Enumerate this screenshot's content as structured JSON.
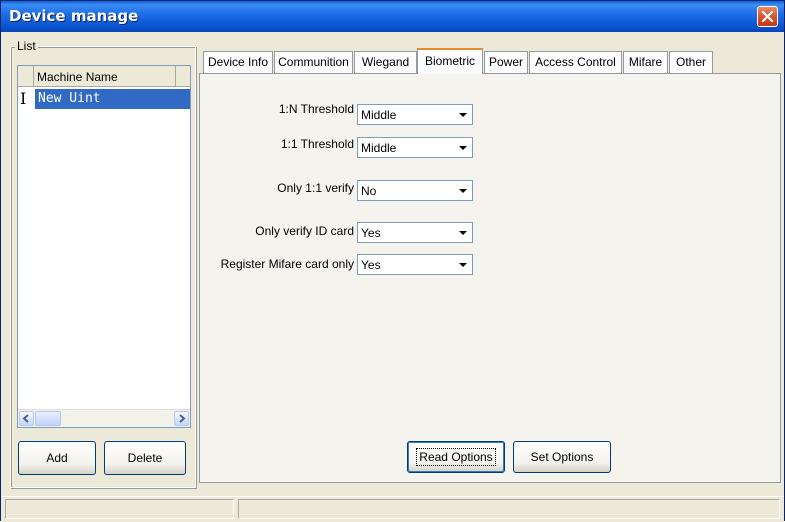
{
  "window": {
    "title": "Device manage"
  },
  "list": {
    "group_label": "List",
    "column_header": "Machine Name",
    "rows": [
      {
        "indicator": "I",
        "name": "New Uint"
      }
    ],
    "add_label": "Add",
    "delete_label": "Delete"
  },
  "tabs": [
    {
      "label": "Device Info"
    },
    {
      "label": "Communition"
    },
    {
      "label": "Wiegand"
    },
    {
      "label": "Biometric"
    },
    {
      "label": "Power"
    },
    {
      "label": "Access Control"
    },
    {
      "label": "Mifare"
    },
    {
      "label": "Other"
    }
  ],
  "active_tab": "Biometric",
  "biometric": {
    "fields": [
      {
        "label": "1:N Threshold",
        "value": "Middle"
      },
      {
        "label": "1:1 Threshold",
        "value": "Middle"
      },
      {
        "label": "Only 1:1 verify",
        "value": "No"
      },
      {
        "label": "Only verify ID card",
        "value": "Yes"
      },
      {
        "label": "Register Mifare card only",
        "value": "Yes"
      }
    ],
    "read_options_label": "Read Options",
    "set_options_label": "Set Options"
  },
  "colors": {
    "titlebar": "#0a5fd8",
    "selection": "#316ac5",
    "active_tab_accent": "#e68b2c",
    "close_button": "#d64a26"
  }
}
